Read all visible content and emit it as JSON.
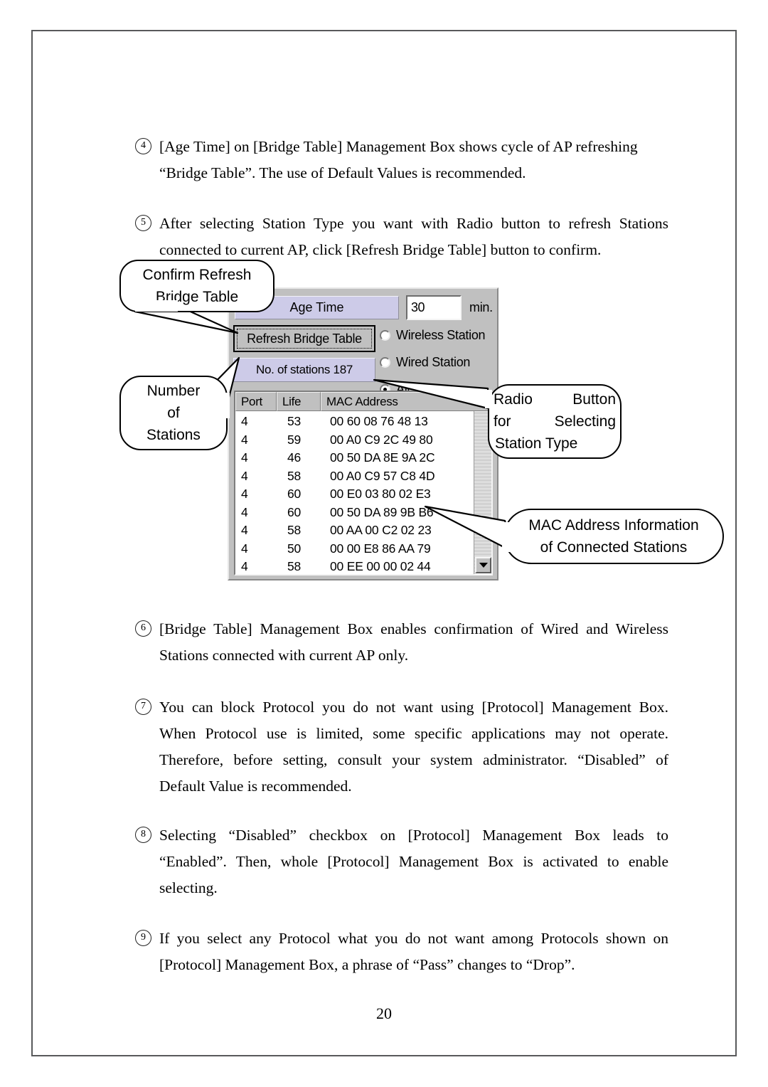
{
  "document": {
    "page_number": "20"
  },
  "paragraphs": [
    {
      "marker": "4",
      "lines": [
        "[Age Time] on [Bridge Table] Management Box shows cycle of AP refreshing",
        "“Bridge Table”. The use of Default Values is recommended."
      ]
    },
    {
      "marker": "5",
      "lines": [
        "After selecting Station Type you want with Radio button to refresh Stations",
        "connected to current AP, click [Refresh Bridge Table] button to confirm."
      ]
    },
    {
      "marker": "6",
      "lines": [
        "[Bridge Table] Management Box enables confirmation of Wired and Wireless",
        "Stations connected with current AP only."
      ]
    },
    {
      "marker": "7",
      "lines": [
        "You can block Protocol you do not want using [Protocol] Management Box.",
        "When Protocol use is limited, some specific applications may not operate.",
        "Therefore, before setting, consult your system administrator. “Disabled” of",
        "Default Value is recommended."
      ]
    },
    {
      "marker": "8",
      "lines": [
        "Selecting “Disabled” checkbox on [Protocol] Management Box leads to",
        "“Enabled”. Then, whole [Protocol] Management Box is activated to enable",
        "selecting."
      ]
    },
    {
      "marker": "9",
      "lines": [
        "If you select any Protocol what you do not want among Protocols shown on",
        "[Protocol] Management Box, a phrase of “Pass” changes to “Drop”."
      ]
    }
  ],
  "figure": {
    "dialog": {
      "age_time_label": "Age Time",
      "age_time_value": "30",
      "age_time_unit": "min.",
      "refresh_button": "Refresh Bridge Table",
      "stations_count_label": "No. of stations 187",
      "radio_options": [
        {
          "label": "Wireless Station",
          "selected": false
        },
        {
          "label": "Wired Station",
          "selected": false
        },
        {
          "label": "All",
          "selected": true
        }
      ],
      "table": {
        "columns": [
          "Port",
          "Life",
          "MAC Address"
        ],
        "rows": [
          [
            "4",
            "53",
            "00 60 08 76 48 13"
          ],
          [
            "4",
            "59",
            "00 A0 C9 2C 49 80"
          ],
          [
            "4",
            "46",
            "00 50 DA 8E 9A 2C"
          ],
          [
            "4",
            "58",
            "00 A0 C9 57 C8 4D"
          ],
          [
            "4",
            "60",
            "00 E0 03 80 02 E3"
          ],
          [
            "4",
            "60",
            "00 50 DA 89 9B B6"
          ],
          [
            "4",
            "58",
            "00 AA 00 C2 02 23"
          ],
          [
            "4",
            "50",
            "00 00 E8 86 AA 79"
          ],
          [
            "4",
            "58",
            "00 EE 00 00 02 44"
          ]
        ]
      },
      "colors": {
        "dialog_face": "#c0c0c0",
        "lavender_panel": "#cdcbe8",
        "field_background": "#ffffff"
      }
    },
    "callouts": {
      "confirm_refresh": [
        "Confirm Refresh",
        "Bridge Table"
      ],
      "number_of_stations": [
        "Number",
        "of",
        "Stations"
      ],
      "radio_button": [
        [
          "Radio",
          "Button"
        ],
        [
          "for",
          "Selecting"
        ],
        [
          "Station Type"
        ]
      ],
      "mac_address_info": [
        "MAC Address Information",
        "of Connected Stations"
      ]
    }
  }
}
